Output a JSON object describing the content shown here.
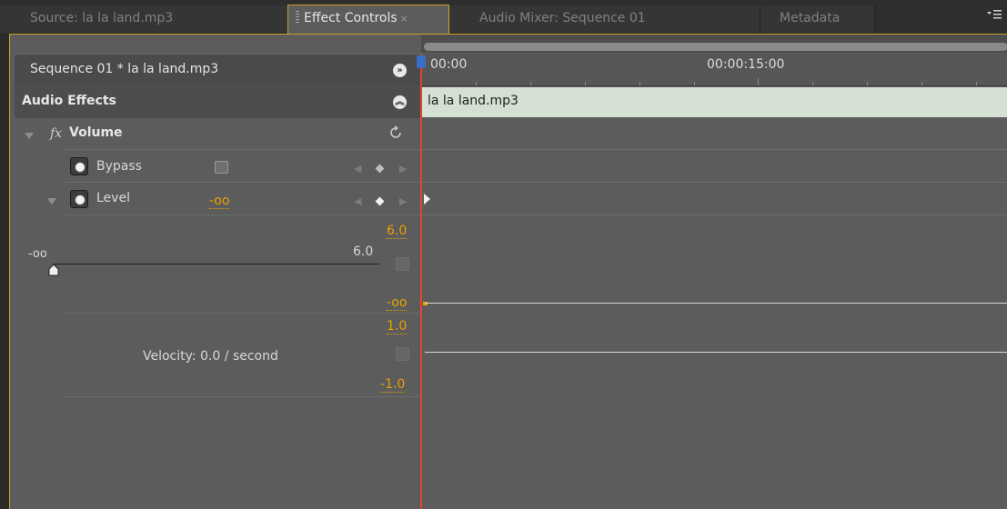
{
  "tabs": [
    {
      "label": "Source: la la land.mp3",
      "active": false
    },
    {
      "label": "Effect Controls",
      "active": true,
      "close": "×"
    },
    {
      "label": "Audio Mixer: Sequence 01",
      "active": false
    },
    {
      "label": "Metadata",
      "active": false
    }
  ],
  "panel_menu_icon": "panel-menu-icon",
  "sequence_label": "Sequence 01 * la la land.mp3",
  "section_title": "Audio Effects",
  "effect": {
    "fx_glyph": "fx",
    "name": "Volume",
    "reset_icon": "reset-icon"
  },
  "bypass": {
    "label": "Bypass",
    "checked": false
  },
  "level": {
    "label": "Level",
    "value": "-oo",
    "graph_max": "6.0",
    "slider_min": "-oo",
    "slider_max": "6.0",
    "graph_min": "-oo",
    "velocity_max": "1.0",
    "velocity_label": "Velocity: 0.0 / second",
    "velocity_min": "-1.0",
    "slider_position": 0.0
  },
  "timeline": {
    "start_tc": "00:00",
    "mid_tc": "00:00:15:00",
    "clip_name": "la la land.mp3"
  },
  "colors": {
    "accent_gold": "#e8a200",
    "playhead": "#e5432f",
    "clip_bg": "#d4e0d1",
    "panel_border": "#c9a227"
  }
}
